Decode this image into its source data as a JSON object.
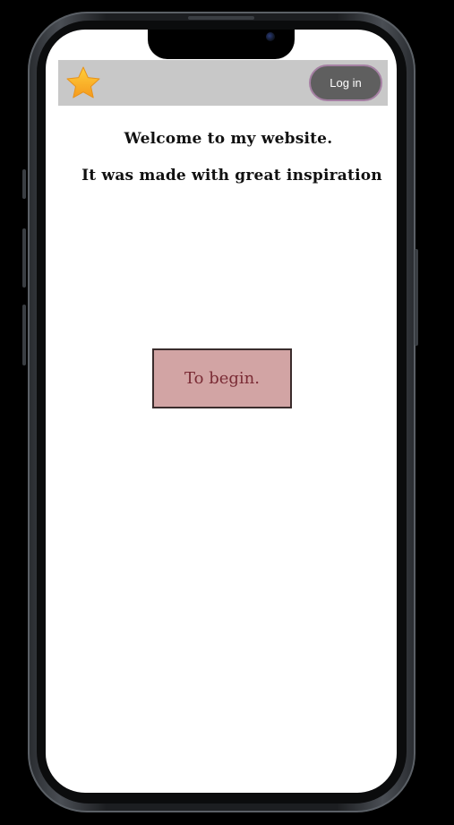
{
  "navbar": {
    "logo_icon": "star-icon",
    "login_label": "Log in"
  },
  "main": {
    "welcome_text": "Welcome to my website.",
    "inspiration_text": "It was made with great inspiration",
    "begin_label": "To begin."
  },
  "colors": {
    "navbar_bg": "#c8c8c8",
    "login_bg": "#5f5f5f",
    "login_border": "#a580a3",
    "begin_bg": "#d2a4a4",
    "begin_text": "#7a2b35",
    "star": "#f7b52c"
  }
}
